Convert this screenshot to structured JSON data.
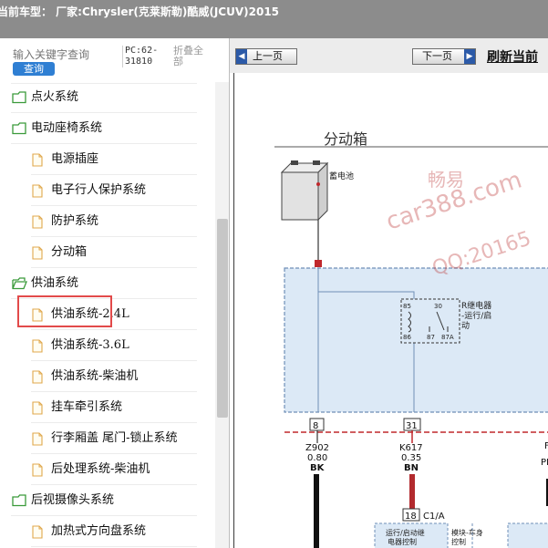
{
  "window": {
    "title": "当前车型：  厂家:Chrysler(克莱斯勒)酷威(JCUV)2015"
  },
  "sidebar": {
    "search": {
      "placeholder": "输入关键字查询",
      "button_label": "查询"
    },
    "pc_code": "PC:62-31810",
    "collapse_all_label": "折叠全部",
    "tree": [
      {
        "type": "folder",
        "label": "点火系统"
      },
      {
        "type": "folder",
        "label": "电动座椅系统"
      },
      {
        "type": "doc",
        "label": "电源插座"
      },
      {
        "type": "doc",
        "label": "电子行人保护系统"
      },
      {
        "type": "doc",
        "label": "防护系统"
      },
      {
        "type": "doc",
        "label": "分动箱",
        "selected": true
      },
      {
        "type": "folder",
        "label": "供油系统",
        "open": true
      },
      {
        "type": "doc",
        "label": "供油系统-2.4L"
      },
      {
        "type": "doc",
        "label": "供油系统-3.6L"
      },
      {
        "type": "doc",
        "label": "供油系统-柴油机"
      },
      {
        "type": "doc",
        "label": "挂车牵引系统"
      },
      {
        "type": "doc",
        "label": "行李厢盖 尾门-锁止系统"
      },
      {
        "type": "doc",
        "label": "后处理系统-柴油机"
      },
      {
        "type": "folder",
        "label": "后视摄像头系统"
      },
      {
        "type": "doc",
        "label": "加热式方向盘系统"
      }
    ]
  },
  "document": {
    "prev_label": "上一页",
    "next_label": "下一页",
    "refresh_label": "刷新当前",
    "diagram": {
      "title": "分动箱",
      "battery_label": "蓄电池",
      "relay_label_1": "R继电器",
      "relay_label_2": "-运行/启",
      "relay_label_3": "动",
      "pin_85": "85",
      "pin_30": "30",
      "pin_86": "86",
      "pin_87": "87",
      "pin_87a": "87A",
      "conn_left_num": "8",
      "conn_mid_num": "31",
      "left_wire_1": "Z902",
      "left_wire_2": "0.80",
      "left_wire_3": "BK",
      "mid_wire_1": "K617",
      "mid_wire_2": "0.35",
      "mid_wire_3": "BN",
      "conn_c1_num": "18",
      "conn_c1_label": "C1/A",
      "module_label_1": "运行/启动继",
      "module_label_2": "电器控制",
      "body_module_1": "模块-车身",
      "body_module_2": "控制",
      "right_partial_1": "F",
      "right_partial_2": "PI"
    },
    "watermark": {
      "line1": "畅易",
      "line2": "car388.com",
      "line3": "QQ:20165"
    }
  },
  "colors": {
    "title_bar": "#8c8c8c",
    "search_button": "#2f7fd3",
    "highlight_border": "#e24a4a",
    "diagram_blue_fill": "#dce9f6",
    "wire_red": "#c0282c",
    "folder_green": "#3a9a3a"
  }
}
